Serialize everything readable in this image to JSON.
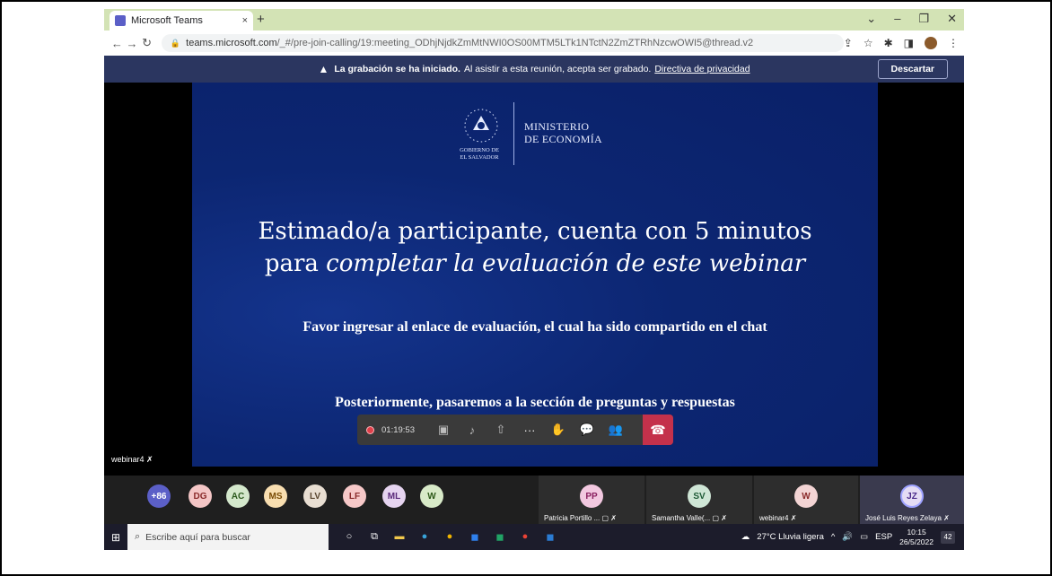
{
  "browser": {
    "tab_title": "Microsoft Teams",
    "tab_close": "×",
    "new_tab": "+",
    "url_host": "teams.microsoft.com",
    "url_path": "/_#/pre-join-calling/19:meeting_ODhjNjdkZmMtNWI0OS00MTM5LTk1NTctN2ZmZTRhNzcwOWI5@thread.v2",
    "window_controls": [
      "⌄",
      "–",
      "❐",
      "✕"
    ]
  },
  "banner": {
    "bold_text": "La grabación se ha iniciado.",
    "text": "Al asistir a esta reunión, acepta ser grabado.",
    "link": "Directiva de privacidad",
    "dismiss_label": "Descartar"
  },
  "slide": {
    "logo_line1": "MINISTERIO",
    "logo_line2": "DE ECONOMÍA",
    "gov_line1": "GOBIERNO DE",
    "gov_line2": "EL SALVADOR",
    "headline_line1": "Estimado/a participante, cuenta con 5 minutos",
    "headline_line2_plain": "para",
    "headline_line2_italic": "completar la evaluación de este webinar",
    "subtitle1": "Favor ingresar al enlace de evaluación, el cual ha sido compartido en el chat",
    "subtitle2": "Posteriormente, pasaremos a la sección de preguntas y respuestas"
  },
  "presenter_label": "webinar4",
  "controls": {
    "timer": "01:19:53"
  },
  "participants": {
    "overflow": "+86",
    "avatars": [
      {
        "initials": "DG",
        "color": "#f4c6c6",
        "text": "#8a2a2a"
      },
      {
        "initials": "AC",
        "color": "#d4e8cc",
        "text": "#2c5a1e"
      },
      {
        "initials": "MS",
        "color": "#f8deb0",
        "text": "#7a4c06"
      },
      {
        "initials": "LV",
        "color": "#e8ded2",
        "text": "#5a4630"
      },
      {
        "initials": "LF",
        "color": "#f6c8c8",
        "text": "#8a2a2a"
      },
      {
        "initials": "ML",
        "color": "#e6d4f0",
        "text": "#5a2a7a"
      },
      {
        "initials": "W",
        "color": "#d8eac8",
        "text": "#2e5a1a"
      }
    ],
    "tiles": [
      {
        "initials": "PP",
        "name": "Patricia Portillo ...",
        "color": "#f2c8e0",
        "text": "#8a2060"
      },
      {
        "initials": "SV",
        "name": "Samantha Valle(...",
        "color": "#cfe6d6",
        "text": "#1e5a36"
      },
      {
        "initials": "W",
        "name": "webinar4",
        "color": "#f3d4d4",
        "text": "#8a2a2a"
      },
      {
        "initials": "JZ",
        "name": "José Luis Reyes Zelaya",
        "color": "#e4dcf4",
        "text": "#4a2a8a"
      }
    ]
  },
  "taskbar": {
    "search_placeholder": "Escribe aquí para buscar",
    "weather": "27°C  Lluvia ligera",
    "lang": "ESP",
    "time": "10:15",
    "date": "26/5/2022",
    "notifications": "42"
  }
}
